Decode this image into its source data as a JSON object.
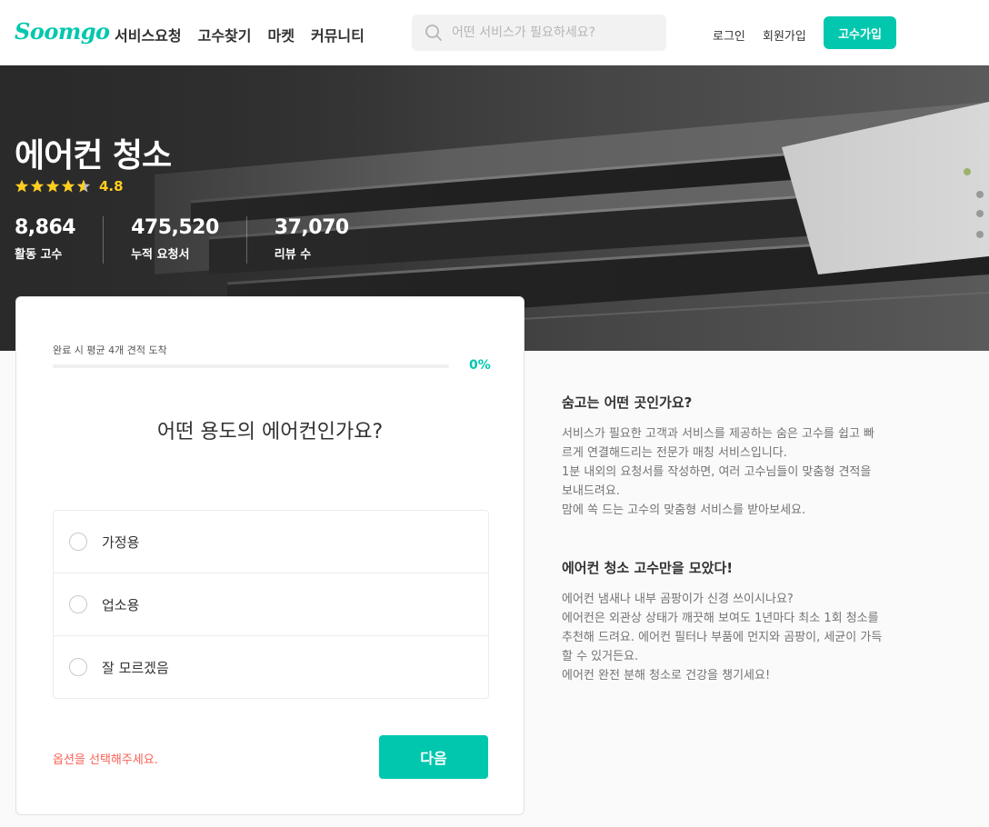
{
  "header": {
    "logo": "Soomgo",
    "nav": [
      "서비스요청",
      "고수찾기",
      "마켓",
      "커뮤니티"
    ],
    "search_placeholder": "어떤 서비스가 필요하세요?",
    "login": "로그인",
    "signup": "회원가입",
    "pro_signup": "고수가입"
  },
  "hero": {
    "title": "에어컨 청소",
    "rating": {
      "value": "4.8",
      "stars": 4.8
    },
    "stats": [
      {
        "value": "8,864",
        "label": "활동 고수"
      },
      {
        "value": "475,520",
        "label": "누적 요청서"
      },
      {
        "value": "37,070",
        "label": "리뷰 수"
      }
    ]
  },
  "form": {
    "progress_label": "완료 시 평균 4개 견적 도착",
    "progress_percent": "0%",
    "progress": 0,
    "question": "어떤 용도의 에어컨인가요?",
    "options": [
      "가정용",
      "업소용",
      "잘 모르겠음"
    ],
    "error": "옵션을 선택해주세요.",
    "next": "다음"
  },
  "info": {
    "about_title": "숨고는 어떤 곳인가요?",
    "about_lines": [
      "서비스가 필요한 고객과 서비스를 제공하는 숨은 고수를 쉽고 빠",
      "르게 연결해드리는 전문가 매칭 서비스입니다.",
      "1분 내외의 요청서를 작성하면, 여러 고수님들이 맞춤형 견적을",
      "보내드려요.",
      "맘에 쏙 드는 고수의 맞춤형 서비스를 받아보세요."
    ],
    "service_title": "에어컨 청소 고수만을 모았다!",
    "service_lines": [
      "에어컨 냄새나 내부 곰팡이가 신경 쓰이시나요?",
      "에어컨은 외관상 상태가 깨끗해 보여도 1년마다 최소 1회 청소를",
      "추천해 드려요. 에어컨 필터나 부품에 먼지와 곰팡이, 세균이 가득",
      "할 수 있거든요.",
      "에어컨 완전 분해 청소로 건강을 챙기세요!"
    ]
  },
  "colors": {
    "brand": "#00c7ae",
    "star": "#ffce21",
    "error": "#fa5f55"
  }
}
